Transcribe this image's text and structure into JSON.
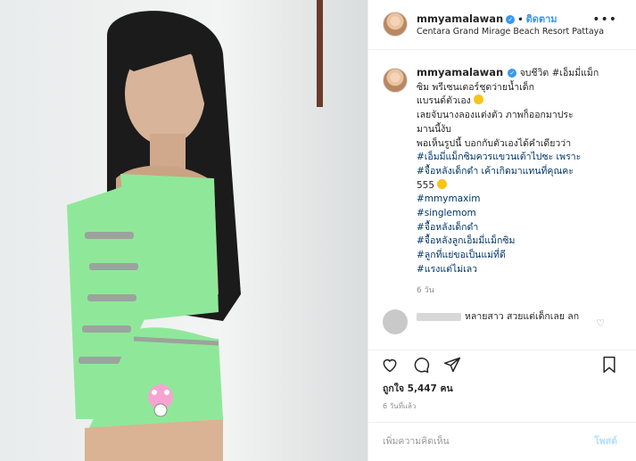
{
  "post": {
    "username": "mmyamalawan",
    "verified_symbol": "✓",
    "follow_label": "ติดตาม",
    "location": "Centara Grand Mirage Beach Resort Pattaya",
    "more_symbol": "•••"
  },
  "caption": {
    "lines": [
      "จบชีวิต #เอ็มมี่แม็ก",
      "ซิม พรีเซนเตอร์ชุดว่ายน้ำเด็ก",
      "แบรนด์ตัวเอง",
      "เลยจับนางลองแต่งตัว ภาพก็ออกมาประ",
      "มานนี้งับ",
      "พอเห็นรูปนี้ บอกกับตัวเองได้คำเดียวว่า",
      "#เอ็มมี่แม็กซิมควรแขวนเต้าไปซะ เพราะ",
      "#จื้อหลังเด็กดำ เค้าเกิดมาแทนที่คุณคะ",
      "555"
    ],
    "hashtags": [
      "#mmymaxim",
      "#singlemom",
      "#จื้อหลังเด็กดำ",
      "#จื้อหลังลูกเอ็มมี่แม็กซิม",
      "#ลูกที่แย่ขอเป็นแม่ที่ดี",
      "#แรงแต่ไม่เลว"
    ],
    "time_ago": "6 วัน"
  },
  "comment": {
    "text": "หลายสาว สวยแต่เด็กเลย ลก",
    "heart_symbol": "♡"
  },
  "actions": {
    "likes": "ถูกใจ 5,447 คน",
    "date": "6 วันที่แล้ว",
    "comment_placeholder": "เพิ่มความคิดเห็น",
    "post_label": "โพสต์"
  },
  "icons": {
    "like": "heart-icon",
    "comment": "comment-icon",
    "share": "share-icon",
    "save": "bookmark-icon"
  },
  "colors": {
    "accent": "#3897f0",
    "hashtag": "#003569",
    "outfit": "#8fe89a",
    "background": "#eef0f0"
  }
}
